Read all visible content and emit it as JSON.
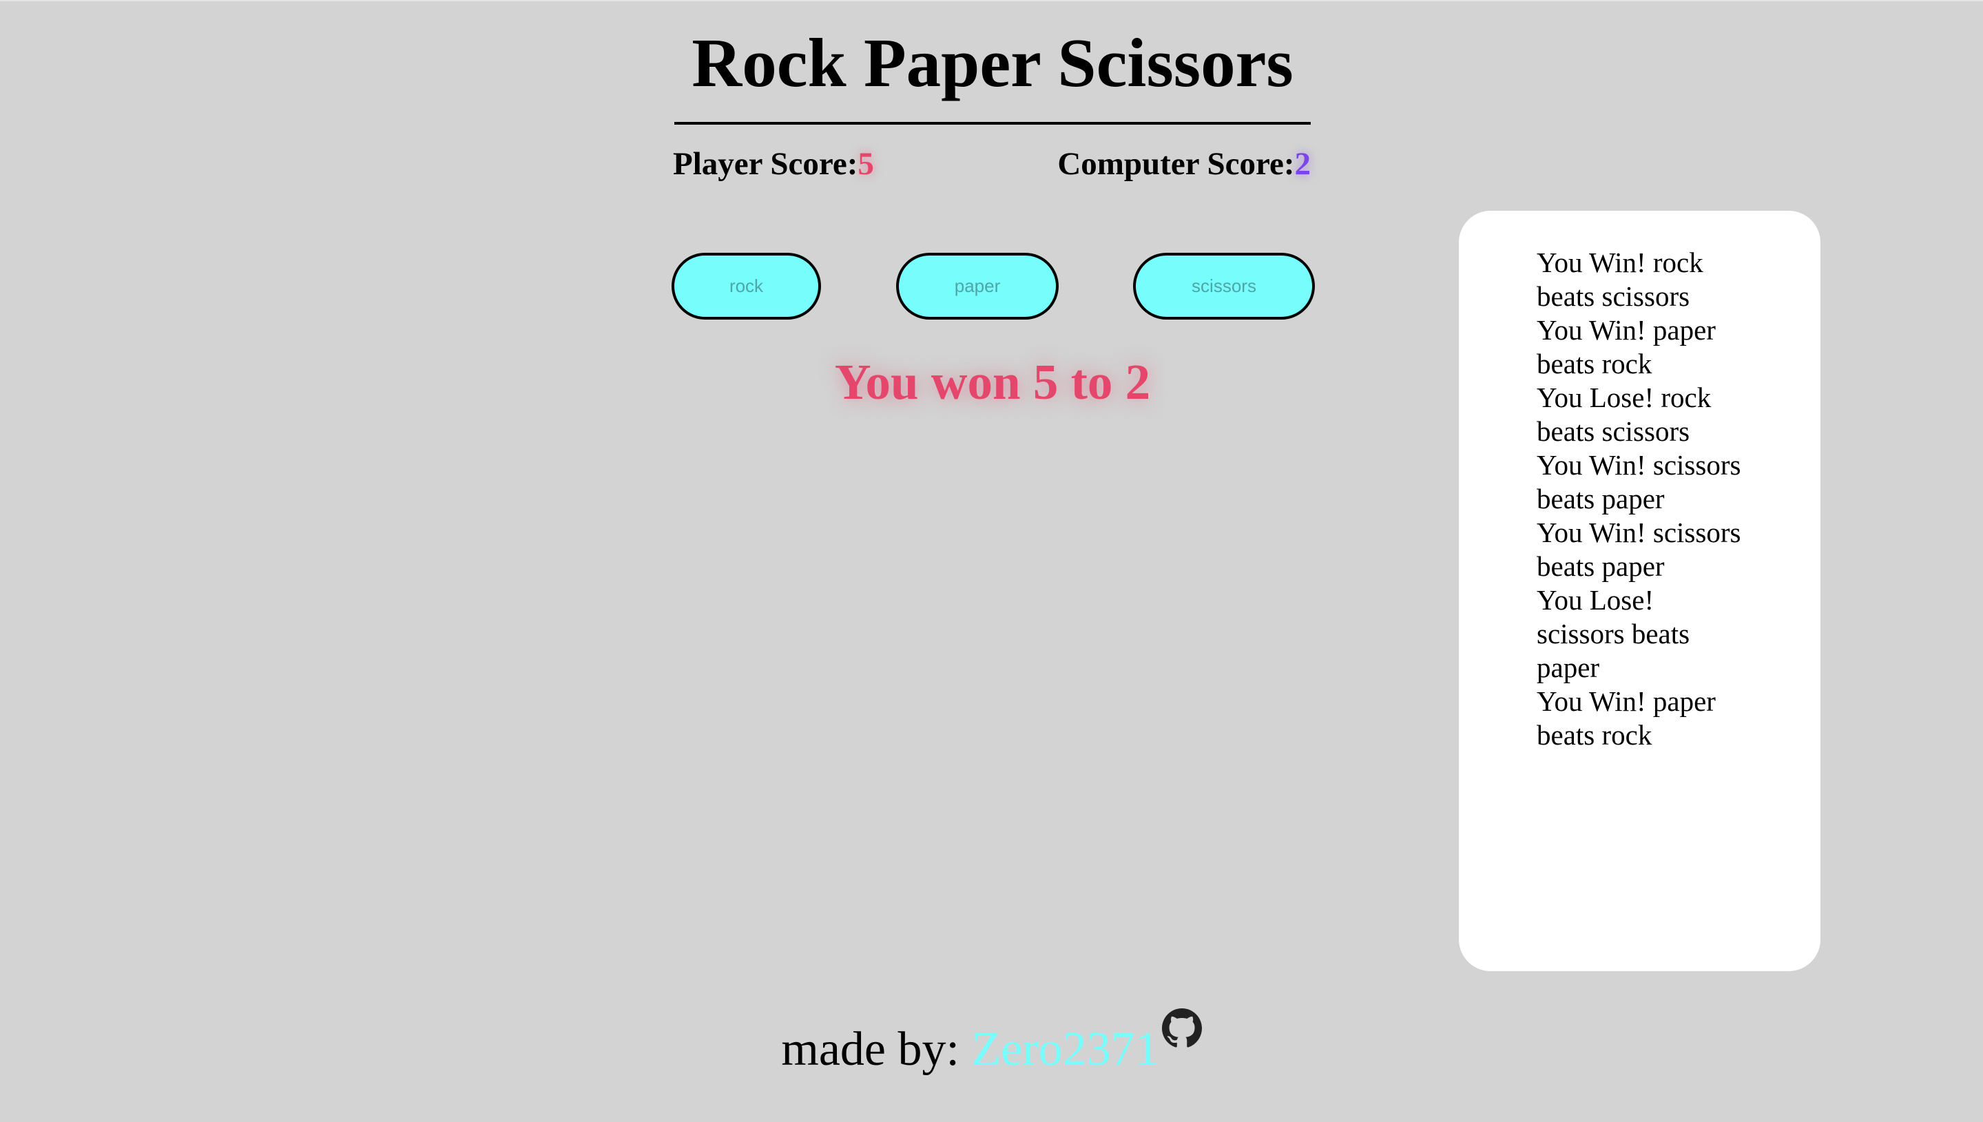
{
  "header": {
    "title": "Rock Paper Scissors"
  },
  "scores": {
    "player_label": "Player Score:",
    "player_value": "5",
    "computer_label": "Computer Score:",
    "computer_value": "2"
  },
  "choices": {
    "rock": "rock",
    "paper": "paper",
    "scissors": "scissors"
  },
  "result": {
    "text": "You won 5 to 2"
  },
  "log": {
    "items": [
      "You Win! rock beats scissors",
      "You Win! paper beats rock",
      "You Lose! rock beats scissors",
      "You Win! scissors beats paper",
      "You Win! scissors beats paper",
      "You Lose! scissors beats paper",
      "You Win! paper beats rock"
    ]
  },
  "footer": {
    "made_by_label": "made by: ",
    "author": "Zero2371",
    "icon": "github-icon"
  },
  "colors": {
    "background": "#d3d3d3",
    "button": "#78fdfd",
    "player_accent": "#e5466b",
    "computer_accent": "#7d45e8",
    "link": "#78fdfd"
  }
}
